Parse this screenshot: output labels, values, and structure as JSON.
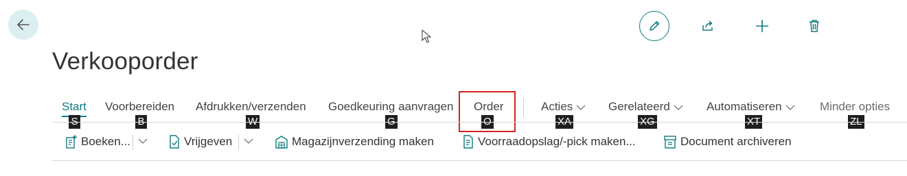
{
  "page": {
    "title": "Verkooporder",
    "accent_color": "#0f7a7e",
    "back_icon": "arrow-left-icon"
  },
  "top_actions": [
    {
      "name": "edit",
      "icon": "pencil-icon"
    },
    {
      "name": "share",
      "icon": "share-icon"
    },
    {
      "name": "new",
      "icon": "plus-icon"
    },
    {
      "name": "delete",
      "icon": "trash-icon"
    }
  ],
  "tabs": [
    {
      "label": "Start",
      "key": "S",
      "active": true
    },
    {
      "label": "Voorbereiden",
      "key": "B"
    },
    {
      "label": "Afdrukken/verzenden",
      "key": "W"
    },
    {
      "label": "Goedkeuring aanvragen",
      "key": "G"
    },
    {
      "label": "Order",
      "key": "O",
      "highlighted": true
    },
    {
      "label": "Acties",
      "key": "XA",
      "dropdown": true
    },
    {
      "label": "Gerelateerd",
      "key": "XG",
      "dropdown": true
    },
    {
      "label": "Automatiseren",
      "key": "XT",
      "dropdown": true
    },
    {
      "label": "Minder opties",
      "key": "ZL"
    }
  ],
  "actions": [
    {
      "label": "Boeken...",
      "icon": "post-document-icon",
      "split_dropdown": true
    },
    {
      "label": "Vrijgeven",
      "icon": "release-document-icon",
      "split_dropdown": true
    },
    {
      "label": "Magazijnverzending maken",
      "icon": "warehouse-shipment-icon"
    },
    {
      "label": "Voorraadopslag/-pick maken...",
      "icon": "inventory-pick-icon"
    },
    {
      "label": "Document archiveren",
      "icon": "archive-document-icon"
    }
  ]
}
